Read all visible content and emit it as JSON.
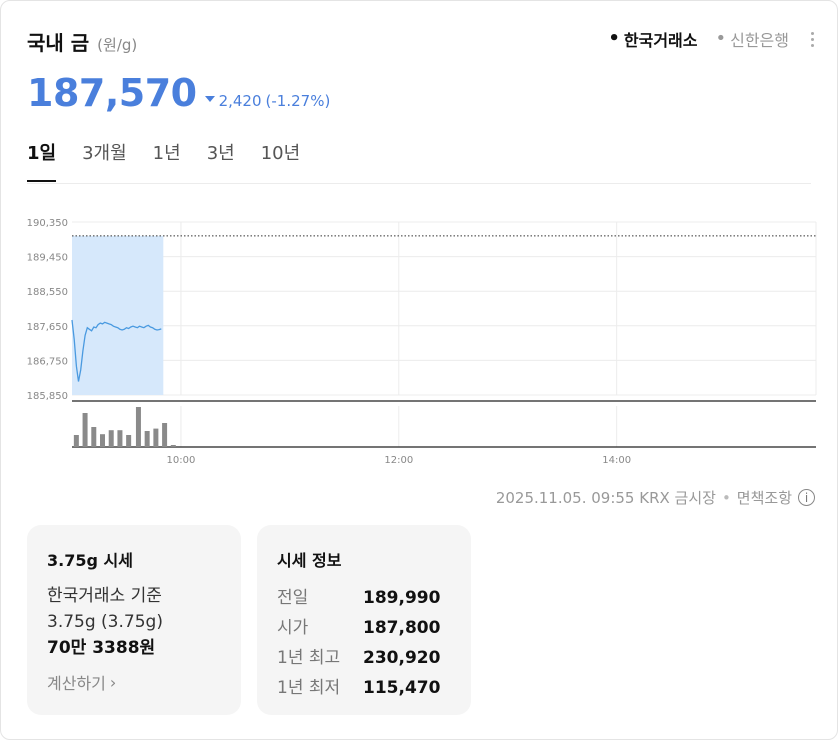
{
  "header": {
    "title": "국내 금",
    "unit": "(원/g)",
    "sources": [
      {
        "label": "한국거래소",
        "active": true
      },
      {
        "label": "신한은행",
        "active": false
      }
    ],
    "more_icon": "more-vertical-icon"
  },
  "price": {
    "value": "187,570",
    "change": "2,420",
    "change_pct": "(-1.27%)",
    "direction": "down",
    "color": "#4a7fdc"
  },
  "tabs": [
    "1일",
    "3개월",
    "1년",
    "3년",
    "10년"
  ],
  "active_tab": "1일",
  "chart_data": {
    "type": "line",
    "y_ticks": [
      "190,350",
      "189,450",
      "188,550",
      "187,650",
      "186,750",
      "185,850"
    ],
    "y_tick_values": [
      190350,
      189450,
      188550,
      187650,
      186750,
      185850
    ],
    "ylim": [
      185850,
      190350
    ],
    "x_ticks": [
      "10:00",
      "12:00",
      "14:00"
    ],
    "x_tick_hours": [
      10,
      12,
      14
    ],
    "xlim_hours": [
      9.0,
      15.83
    ],
    "reference_line": 189990,
    "line_color": "#4a9ae0",
    "fill_color": "#d6e8fb",
    "series": [
      {
        "values": [
          [
            9.0,
            187800
          ],
          [
            9.02,
            187300
          ],
          [
            9.04,
            186600
          ],
          [
            9.06,
            186200
          ],
          [
            9.08,
            186500
          ],
          [
            9.1,
            187000
          ],
          [
            9.12,
            187400
          ],
          [
            9.14,
            187600
          ],
          [
            9.16,
            187560
          ],
          [
            9.18,
            187520
          ],
          [
            9.2,
            187620
          ],
          [
            9.22,
            187600
          ],
          [
            9.24,
            187680
          ],
          [
            9.26,
            187720
          ],
          [
            9.28,
            187700
          ],
          [
            9.3,
            187740
          ],
          [
            9.32,
            187720
          ],
          [
            9.34,
            187700
          ],
          [
            9.36,
            187680
          ],
          [
            9.38,
            187640
          ],
          [
            9.4,
            187620
          ],
          [
            9.42,
            187600
          ],
          [
            9.44,
            187560
          ],
          [
            9.46,
            187540
          ],
          [
            9.48,
            187560
          ],
          [
            9.5,
            187600
          ],
          [
            9.52,
            187580
          ],
          [
            9.54,
            187620
          ],
          [
            9.56,
            187640
          ],
          [
            9.58,
            187620
          ],
          [
            9.6,
            187600
          ],
          [
            9.62,
            187640
          ],
          [
            9.64,
            187620
          ],
          [
            9.66,
            187600
          ],
          [
            9.68,
            187640
          ],
          [
            9.7,
            187660
          ],
          [
            9.72,
            187620
          ],
          [
            9.74,
            187600
          ],
          [
            9.76,
            187560
          ],
          [
            9.78,
            187540
          ],
          [
            9.8,
            187550
          ],
          [
            9.82,
            187570
          ]
        ]
      }
    ],
    "volume": [
      [
        9.04,
        0.3
      ],
      [
        9.12,
        0.85
      ],
      [
        9.2,
        0.5
      ],
      [
        9.28,
        0.32
      ],
      [
        9.36,
        0.42
      ],
      [
        9.44,
        0.42
      ],
      [
        9.52,
        0.3
      ],
      [
        9.61,
        1.0
      ],
      [
        9.69,
        0.4
      ],
      [
        9.77,
        0.46
      ],
      [
        9.85,
        0.6
      ],
      [
        9.93,
        0.05
      ]
    ]
  },
  "footnote": {
    "timestamp": "2025.11.05. 09:55 KRX 금시장",
    "separator": "•",
    "disclaimer": "면책조항",
    "icon": "info-icon",
    "icon_glyph": "i"
  },
  "box1": {
    "title": "3.75g 시세",
    "line1": "한국거래소 기준",
    "line2": "3.75g (3.75g)",
    "line3": "70만 3388원",
    "link": "계산하기",
    "chevron": "›"
  },
  "box2": {
    "title": "시세 정보",
    "rows": [
      {
        "label": "전일",
        "value": "189,990"
      },
      {
        "label": "시가",
        "value": "187,800"
      },
      {
        "label": "1년 최고",
        "value": "230,920"
      },
      {
        "label": "1년 최저",
        "value": "115,470"
      }
    ]
  }
}
